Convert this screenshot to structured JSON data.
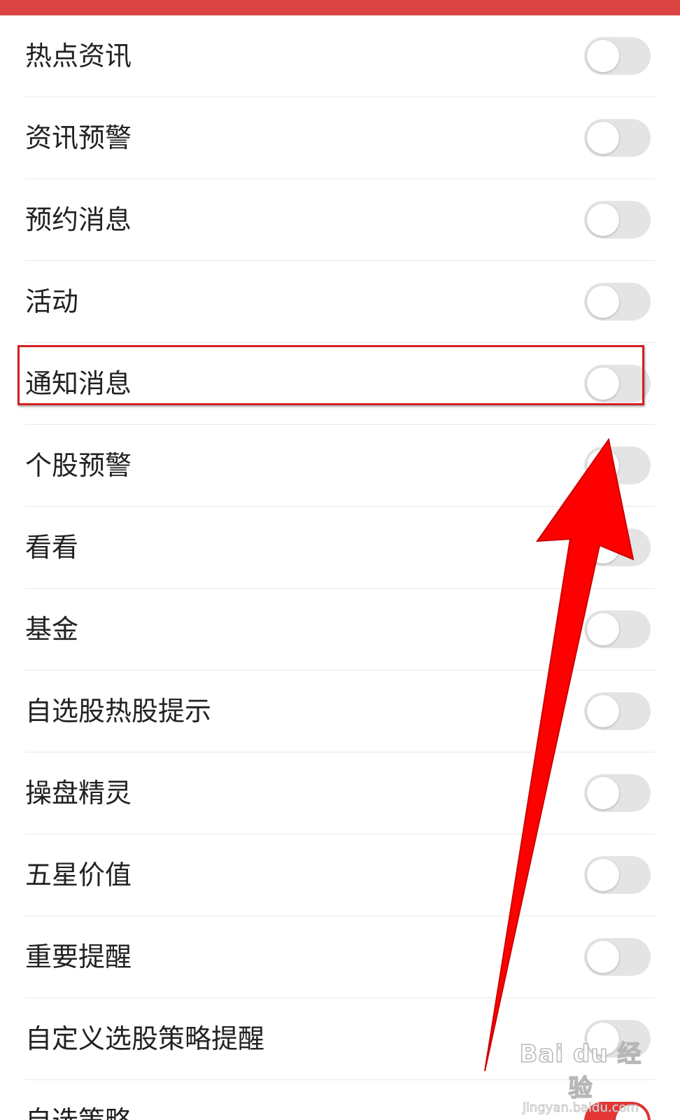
{
  "settings": {
    "items": [
      {
        "label": "热点资讯",
        "enabled": false
      },
      {
        "label": "资讯预警",
        "enabled": false
      },
      {
        "label": "预约消息",
        "enabled": false
      },
      {
        "label": "活动",
        "enabled": false
      },
      {
        "label": "通知消息",
        "enabled": false,
        "highlighted": true
      },
      {
        "label": "个股预警",
        "enabled": false
      },
      {
        "label": "看看",
        "enabled": false
      },
      {
        "label": "基金",
        "enabled": false
      },
      {
        "label": "自选股热股提示",
        "enabled": false
      },
      {
        "label": "操盘精灵",
        "enabled": false
      },
      {
        "label": "五星价值",
        "enabled": false
      },
      {
        "label": "重要提醒",
        "enabled": false
      },
      {
        "label": "自定义选股策略提醒",
        "enabled": false
      },
      {
        "label": "自选策略",
        "enabled": true
      }
    ]
  },
  "annotation": {
    "highlight_color": "#d42020",
    "arrow_color": "#ff0000",
    "arrow_target": "通知消息"
  },
  "watermark": {
    "brand": "Bai du 经验",
    "url": "jingyan.baidu.com"
  },
  "colors": {
    "header_bar": "#dc4444",
    "toggle_off": "#e4e4e4",
    "toggle_on": "#e53535"
  }
}
